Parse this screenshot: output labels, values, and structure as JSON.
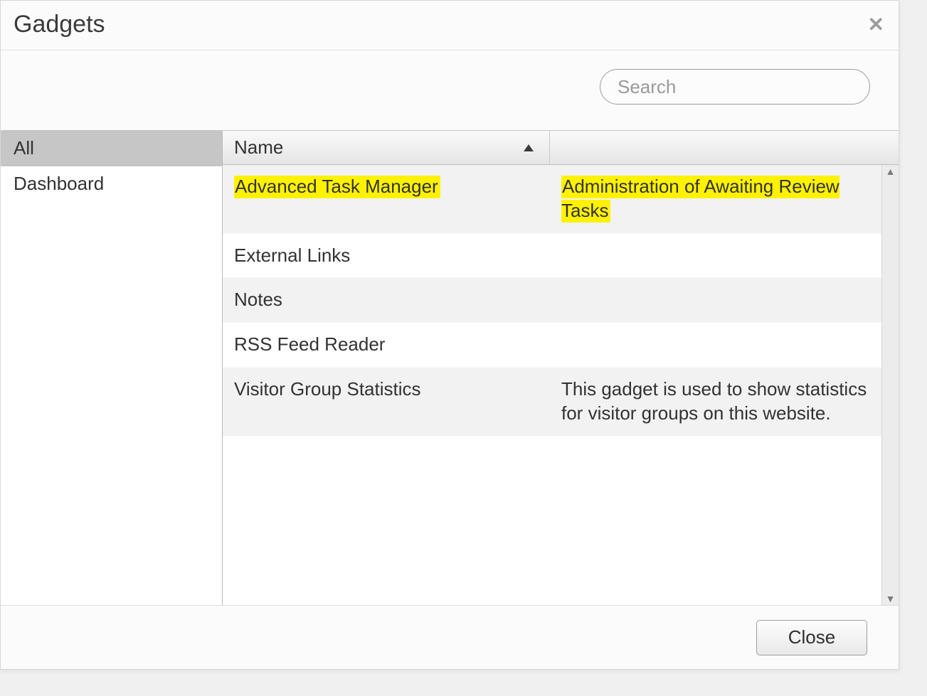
{
  "dialog": {
    "title": "Gadgets",
    "close_button_label": "Close"
  },
  "search": {
    "placeholder": "Search",
    "value": ""
  },
  "sidebar": {
    "items": [
      {
        "label": "All",
        "selected": true
      },
      {
        "label": "Dashboard",
        "selected": false
      }
    ]
  },
  "table": {
    "columns": {
      "name": "Name",
      "description": ""
    },
    "sort": {
      "column": "name",
      "direction": "asc"
    },
    "rows": [
      {
        "name": "Advanced Task Manager",
        "description": "Administration of Awaiting Review Tasks",
        "highlight_name": true,
        "highlight_desc": true
      },
      {
        "name": "External Links",
        "description": ""
      },
      {
        "name": "Notes",
        "description": ""
      },
      {
        "name": "RSS Feed Reader",
        "description": ""
      },
      {
        "name": "Visitor Group Statistics",
        "description": "This gadget is used to show statistics for visitor groups on this website."
      }
    ]
  }
}
